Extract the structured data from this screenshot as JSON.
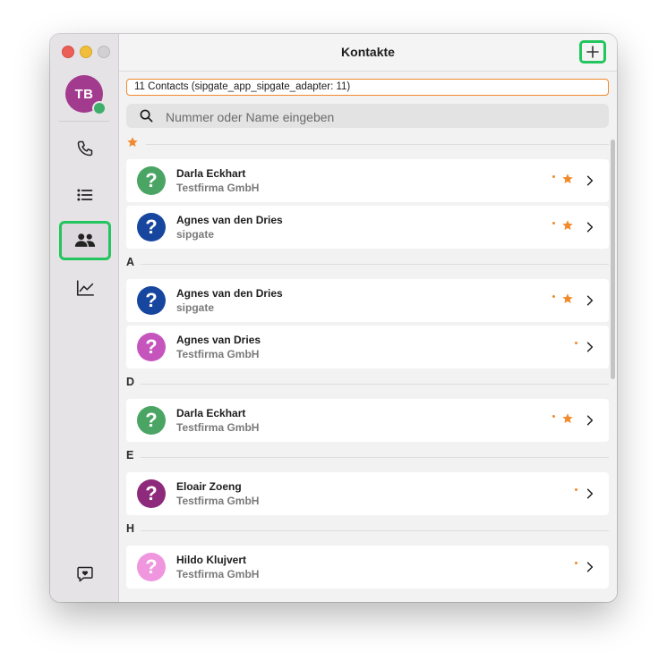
{
  "window": {
    "title": "Kontakte"
  },
  "sidebar": {
    "user_initials": "TB",
    "items": [
      {
        "name": "phone-icon"
      },
      {
        "name": "list-icon"
      },
      {
        "name": "contacts-icon",
        "active": true
      },
      {
        "name": "chart-icon"
      }
    ],
    "feedback_icon": "heart-chat-icon"
  },
  "toolbar": {
    "add_icon": "plus-icon"
  },
  "banner": {
    "text": "11 Contacts (sipgate_app_sipgate_adapter: 11)"
  },
  "search": {
    "placeholder": "Nummer oder Name eingeben",
    "value": ""
  },
  "sections": [
    {
      "label": "",
      "favorite": true,
      "contacts": [
        {
          "name": "Darla Eckhart",
          "company": "Testfirma GmbH",
          "avatar_color": "#4aa564",
          "favorite": true
        },
        {
          "name": "Agnes van den Dries",
          "company": "sipgate",
          "avatar_color": "#17469e",
          "favorite": true
        }
      ]
    },
    {
      "label": "A",
      "favorite": false,
      "contacts": [
        {
          "name": "Agnes van den Dries",
          "company": "sipgate",
          "avatar_color": "#17469e",
          "favorite": true
        },
        {
          "name": "Agnes van Dries",
          "company": "Testfirma GmbH",
          "avatar_color": "#c555bd",
          "favorite": false
        }
      ]
    },
    {
      "label": "D",
      "favorite": false,
      "contacts": [
        {
          "name": "Darla Eckhart",
          "company": "Testfirma GmbH",
          "avatar_color": "#4aa564",
          "favorite": true
        }
      ]
    },
    {
      "label": "E",
      "favorite": false,
      "contacts": [
        {
          "name": "Eloair Zoeng",
          "company": "Testfirma GmbH",
          "avatar_color": "#8e2a7c",
          "favorite": false
        }
      ]
    },
    {
      "label": "H",
      "favorite": false,
      "contacts": [
        {
          "name": "Hildo Klujvert",
          "company": "Testfirma GmbH",
          "avatar_color": "#ef96df",
          "favorite": false
        }
      ]
    }
  ],
  "colors": {
    "accent": "#f08a2c",
    "highlight": "#22c55e",
    "presence": "#3fae6a"
  }
}
